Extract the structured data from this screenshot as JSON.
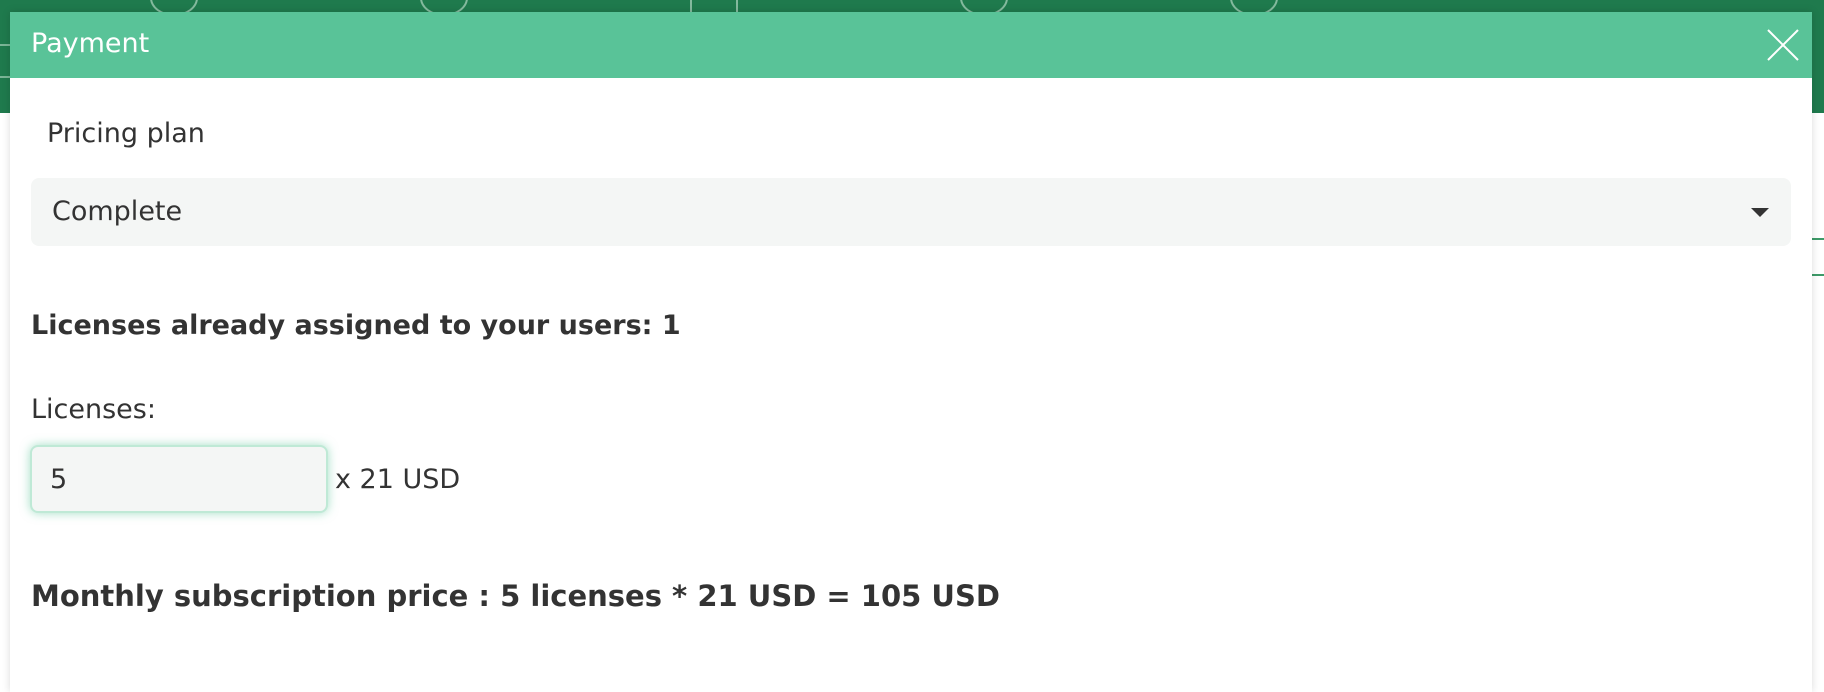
{
  "modal": {
    "title": "Payment"
  },
  "pricing_plan": {
    "label": "Pricing plan",
    "selected": "Complete"
  },
  "licenses_assigned_text": "Licenses already assigned to your users: 1",
  "licenses": {
    "label": "Licenses:",
    "value": "5",
    "unit_price_text": "x 21 USD"
  },
  "monthly_price_text": "Monthly subscription price : 5 licenses * 21 USD = 105 USD",
  "colors": {
    "header": "#59c398",
    "app_topbar": "#1f7a4d",
    "text": "#333333",
    "field_bg": "#f4f6f5"
  },
  "icons": {
    "close": "close-icon",
    "dropdown": "caret-down-icon"
  }
}
